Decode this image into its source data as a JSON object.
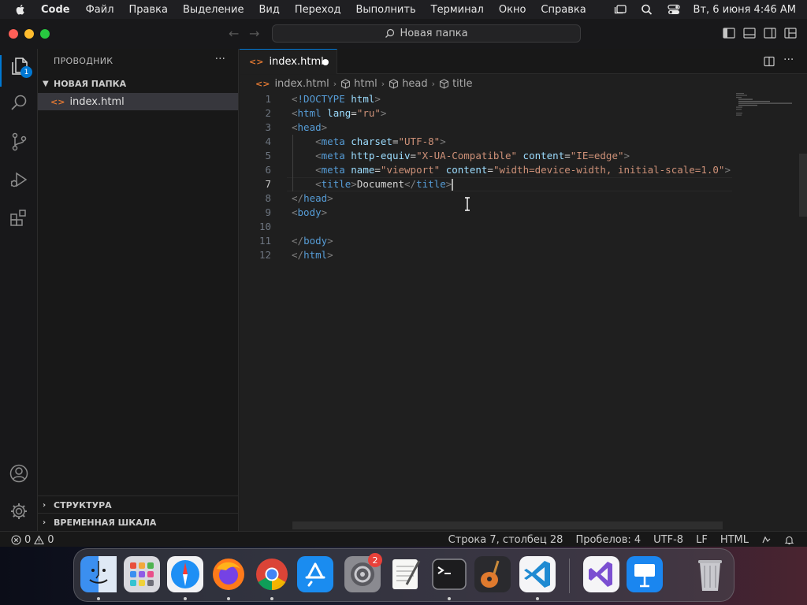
{
  "menubar": {
    "app": "Code",
    "items": [
      "Файл",
      "Правка",
      "Выделение",
      "Вид",
      "Переход",
      "Выполнить",
      "Терминал",
      "Окно",
      "Справка"
    ],
    "clock": "Вт, 6 июня  4:46 AM"
  },
  "titlebar": {
    "command_center": "Новая папка"
  },
  "activity": {
    "explorer_badge": "1"
  },
  "sidebar": {
    "title": "ПРОВОДНИК",
    "more": "···",
    "folder": "НОВАЯ ПАПКА",
    "file": "index.html",
    "outline": "СТРУКТУРА",
    "timeline": "ВРЕМЕННАЯ ШКАЛА"
  },
  "editor": {
    "tab_label": "index.html",
    "file_icon": "<>",
    "breadcrumb": [
      "index.html",
      "html",
      "head",
      "title"
    ],
    "lines": [
      {
        "n": "1",
        "segs": [
          [
            "pu",
            "<"
          ],
          [
            "tg",
            "!DOCTYPE"
          ],
          [
            "tx",
            " "
          ],
          [
            "at",
            "html"
          ],
          [
            "pu",
            ">"
          ]
        ]
      },
      {
        "n": "2",
        "segs": [
          [
            "pu",
            "<"
          ],
          [
            "tg",
            "html"
          ],
          [
            "tx",
            " "
          ],
          [
            "at",
            "lang"
          ],
          [
            "tx",
            "="
          ],
          [
            "st",
            "\"ru\""
          ],
          [
            "pu",
            ">"
          ]
        ]
      },
      {
        "n": "3",
        "segs": [
          [
            "pu",
            "<"
          ],
          [
            "tg",
            "head"
          ],
          [
            "pu",
            ">"
          ]
        ]
      },
      {
        "n": "4",
        "segs": [
          [
            "tx",
            "    "
          ],
          [
            "pu",
            "<"
          ],
          [
            "tg",
            "meta"
          ],
          [
            "tx",
            " "
          ],
          [
            "at",
            "charset"
          ],
          [
            "tx",
            "="
          ],
          [
            "st",
            "\"UTF-8\""
          ],
          [
            "pu",
            ">"
          ]
        ]
      },
      {
        "n": "5",
        "segs": [
          [
            "tx",
            "    "
          ],
          [
            "pu",
            "<"
          ],
          [
            "tg",
            "meta"
          ],
          [
            "tx",
            " "
          ],
          [
            "at",
            "http-equiv"
          ],
          [
            "tx",
            "="
          ],
          [
            "st",
            "\"X-UA-Compatible\""
          ],
          [
            "tx",
            " "
          ],
          [
            "at",
            "content"
          ],
          [
            "tx",
            "="
          ],
          [
            "st",
            "\"IE=edge\""
          ],
          [
            "pu",
            ">"
          ]
        ]
      },
      {
        "n": "6",
        "segs": [
          [
            "tx",
            "    "
          ],
          [
            "pu",
            "<"
          ],
          [
            "tg",
            "meta"
          ],
          [
            "tx",
            " "
          ],
          [
            "at",
            "name"
          ],
          [
            "tx",
            "="
          ],
          [
            "st",
            "\"viewport\""
          ],
          [
            "tx",
            " "
          ],
          [
            "at",
            "content"
          ],
          [
            "tx",
            "="
          ],
          [
            "st",
            "\"width=device-width, initial-scale=1.0\""
          ],
          [
            "pu",
            ">"
          ]
        ]
      },
      {
        "n": "7",
        "segs": [
          [
            "tx",
            "    "
          ],
          [
            "pu",
            "<"
          ],
          [
            "tg",
            "title"
          ],
          [
            "pu",
            ">"
          ],
          [
            "tx",
            "Document"
          ],
          [
            "pu",
            "</"
          ],
          [
            "tg",
            "title"
          ],
          [
            "pu",
            ">"
          ]
        ]
      },
      {
        "n": "8",
        "segs": [
          [
            "pu",
            "</"
          ],
          [
            "tg",
            "head"
          ],
          [
            "pu",
            ">"
          ]
        ]
      },
      {
        "n": "9",
        "segs": [
          [
            "pu",
            "<"
          ],
          [
            "tg",
            "body"
          ],
          [
            "pu",
            ">"
          ]
        ]
      },
      {
        "n": "10",
        "segs": []
      },
      {
        "n": "11",
        "segs": [
          [
            "pu",
            "</"
          ],
          [
            "tg",
            "body"
          ],
          [
            "pu",
            ">"
          ]
        ]
      },
      {
        "n": "12",
        "segs": [
          [
            "pu",
            "</"
          ],
          [
            "tg",
            "html"
          ],
          [
            "pu",
            ">"
          ]
        ]
      }
    ],
    "active_line": "7"
  },
  "statusbar": {
    "errors": "0",
    "warnings": "0",
    "position": "Строка 7, столбец 28",
    "spaces": "Пробелов: 4",
    "encoding": "UTF-8",
    "eol": "LF",
    "language": "HTML"
  },
  "dock": {
    "apps": [
      "finder-icon",
      "launchpad-icon",
      "safari-icon",
      "firefox-icon",
      "chrome-icon",
      "app-store-icon",
      "system-settings-icon",
      "textedit-icon",
      "terminal-icon",
      "garageband-icon",
      "vscode-icon",
      "visual-studio-icon",
      "keynote-icon",
      "trash-icon"
    ],
    "settings_badge": "2"
  },
  "colors": {
    "accent": "#0078d4",
    "tag": "#569cd6",
    "attr": "#9cdcfe",
    "string": "#ce9178",
    "html_icon": "#e37933"
  }
}
